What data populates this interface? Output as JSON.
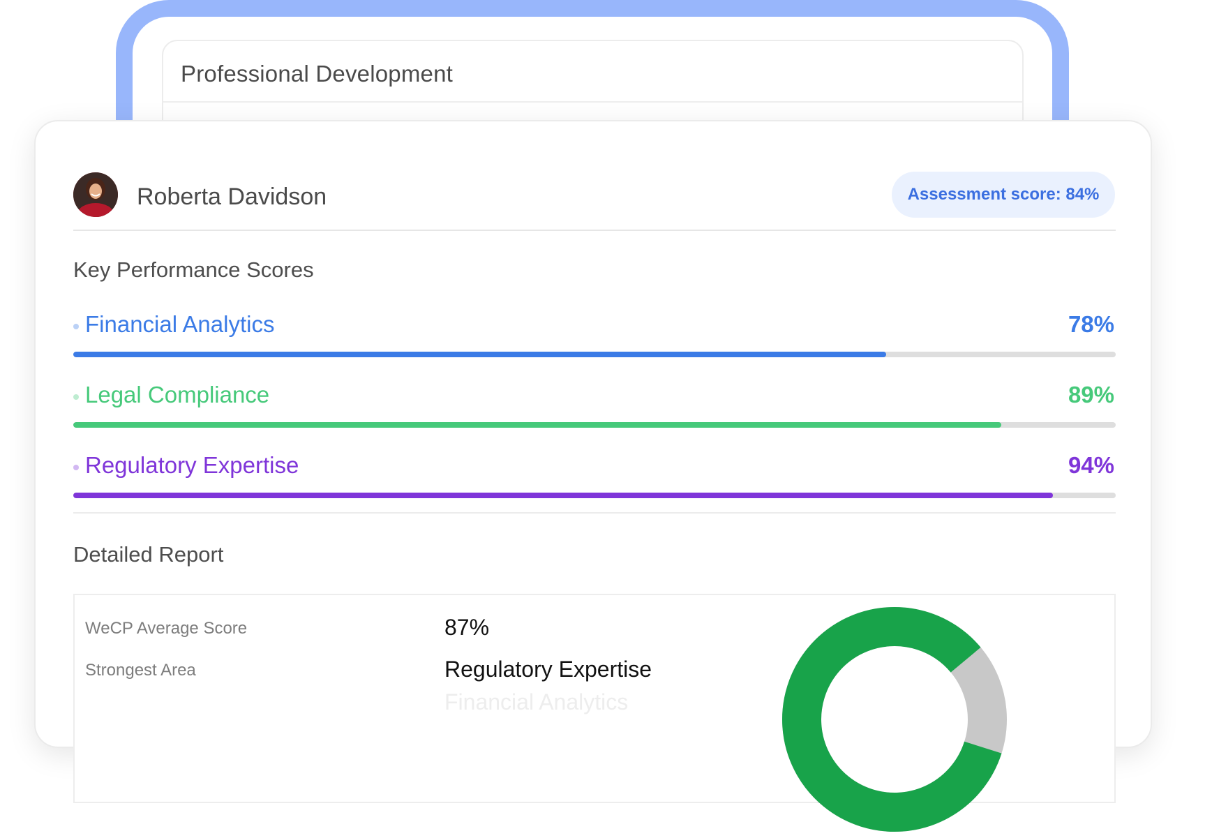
{
  "back_card": {
    "title": "Professional Development"
  },
  "candidate": {
    "name": "Roberta Davidson"
  },
  "badge": {
    "label": "Assessment score: 84%"
  },
  "key_performance": {
    "title": "Key Performance Scores",
    "metrics": [
      {
        "label": "Financial Analytics",
        "value": "78%",
        "progress": 0.78,
        "color": "#3b7be6"
      },
      {
        "label": "Legal Compliance",
        "value": "89%",
        "progress": 0.89,
        "color": "#46c97a"
      },
      {
        "label": "Regulatory Expertise",
        "value": "94%",
        "progress": 0.94,
        "color": "#7f35d9"
      }
    ]
  },
  "detailed_report": {
    "title": "Detailed Report",
    "rows": [
      {
        "key": "WeCP Average Score",
        "value": "87%"
      },
      {
        "key": "Strongest Area",
        "value": "Regulatory Expertise"
      }
    ],
    "faded_value": "Financial Analytics",
    "donut": {
      "primary_fraction": 0.84,
      "primary_color": "#18a34a",
      "secondary_color": "#c8c8c8"
    }
  },
  "icons": {
    "avatar": "user-avatar-photo"
  }
}
